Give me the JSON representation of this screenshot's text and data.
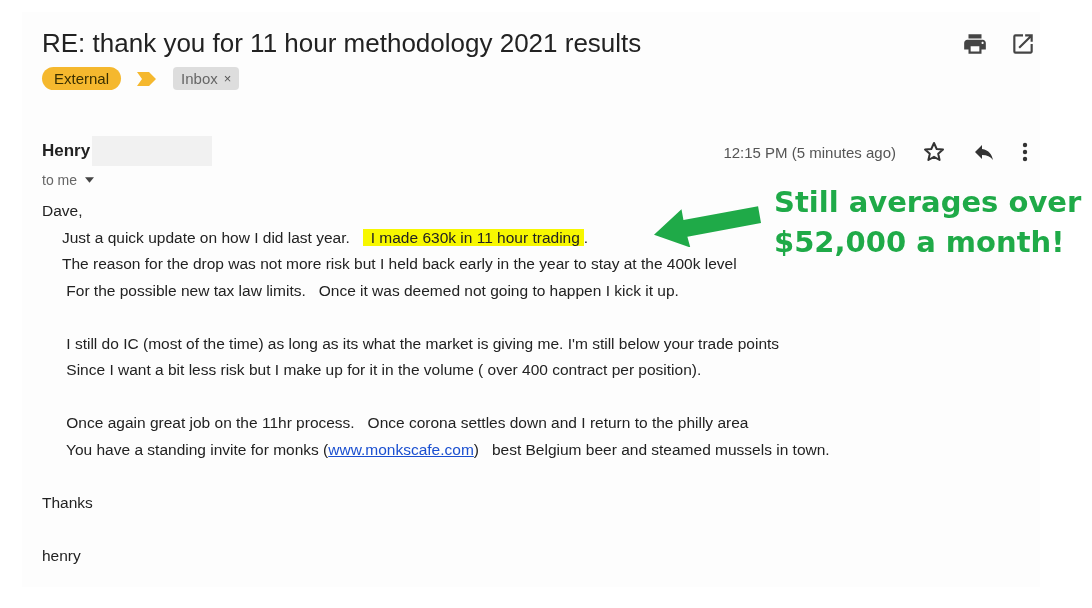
{
  "subject": "RE: thank you for 11 hour methodology 2021 results",
  "labels": [
    {
      "text": "External",
      "kind": "importance"
    },
    {
      "text": "Inbox",
      "kind": "removable",
      "remove": "×"
    }
  ],
  "sender": {
    "name": "Henry",
    "recipient": "to me"
  },
  "time": "12:15 PM (5 minutes ago)",
  "starred": false,
  "paragraphs": [
    {
      "lines": [
        {
          "kind": "flush",
          "parts": [
            {
              "kind": "plain",
              "text": "Dave,"
            }
          ]
        },
        {
          "kind": "indented",
          "parts": [
            {
              "kind": "plain",
              "text": "Just a quick update on how I did last year.   "
            },
            {
              "kind": "highlight",
              "text": "I made 630k in 11 hour trading"
            },
            {
              "kind": "plain",
              "text": "."
            }
          ]
        },
        {
          "kind": "indented",
          "parts": [
            {
              "kind": "plain",
              "text": "The reason for the drop was not more risk but I held back early in the year to stay at the 400k level"
            }
          ]
        },
        {
          "kind": "indented",
          "parts": [
            {
              "kind": "plain",
              "text": " For the possible new tax law limits.   Once it was deemed not going to happen I kick it up."
            }
          ]
        }
      ]
    },
    {
      "lines": [
        {
          "kind": "indented",
          "parts": [
            {
              "kind": "plain",
              "text": " I still do IC (most of the time) as long as its what the market is giving me. I'm still below your trade points"
            }
          ]
        },
        {
          "kind": "indented",
          "parts": [
            {
              "kind": "plain",
              "text": " Since I want a bit less risk but I make up for it in the volume ( over 400 contract per position)."
            }
          ]
        }
      ]
    },
    {
      "lines": [
        {
          "kind": "indented",
          "parts": [
            {
              "kind": "plain",
              "text": " Once again great job on the 11hr process.   Once corona settles down and I return to the philly area"
            }
          ]
        },
        {
          "kind": "indented",
          "parts": [
            {
              "kind": "plain",
              "text": " You have a standing invite for monks ("
            },
            {
              "kind": "link",
              "text": "www.monkscafe.com"
            },
            {
              "kind": "plain",
              "text": ")   best Belgium beer and steamed mussels in town."
            }
          ]
        }
      ]
    },
    {
      "lines": [
        {
          "kind": "flush",
          "parts": [
            {
              "kind": "plain",
              "text": "Thanks"
            }
          ]
        }
      ]
    },
    {
      "lines": [
        {
          "kind": "flush",
          "parts": [
            {
              "kind": "plain",
              "text": "henry"
            }
          ]
        }
      ]
    }
  ],
  "callout": {
    "lines": [
      "Still averages over",
      "$52,000 a month!"
    ]
  }
}
